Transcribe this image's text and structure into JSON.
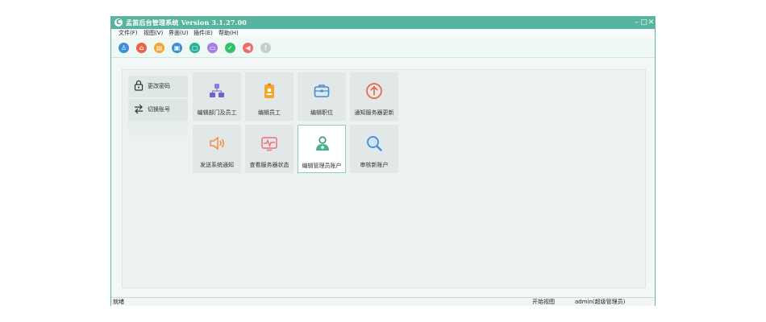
{
  "window": {
    "app_icon": "C",
    "title": "孟笛后台管理系统 Version 3.1.27.00",
    "controls": {
      "minimize": "–",
      "maximize": "□",
      "close": "✕"
    }
  },
  "menu": [
    {
      "label": "文件(F)"
    },
    {
      "label": "视图(V)"
    },
    {
      "label": "界面(U)"
    },
    {
      "label": "插件(E)"
    },
    {
      "label": "帮助(H)"
    }
  ],
  "toolbar": {
    "buttons": [
      {
        "icon": "user-icon",
        "glyph": "♙",
        "color": "#3f8fd8"
      },
      {
        "icon": "home-icon",
        "glyph": "⌂",
        "color": "#f0604a"
      },
      {
        "icon": "document-icon",
        "glyph": "▤",
        "color": "#f2a62c"
      },
      {
        "icon": "id-card-icon",
        "glyph": "▣",
        "color": "#3f8fd8"
      },
      {
        "icon": "contact-icon",
        "glyph": "▢",
        "color": "#28b09a"
      },
      {
        "icon": "keyboard-icon",
        "glyph": "▭",
        "color": "#a67ee6"
      },
      {
        "icon": "check-icon",
        "glyph": "✓",
        "color": "#35c06a"
      },
      {
        "icon": "speaker-icon",
        "glyph": "◀",
        "color": "#f06a6a"
      },
      {
        "icon": "info-icon",
        "glyph": "!",
        "color": "#c9cccc"
      }
    ]
  },
  "sidebar": {
    "change_password": {
      "label": "更改密码",
      "icon": "lock-icon"
    },
    "switch_account": {
      "label": "切换账号",
      "icon": "switch-arrows-icon"
    }
  },
  "tiles": [
    {
      "label": "编辑部门及员工",
      "icon": "org-chart-icon",
      "color": "#8a7fe0"
    },
    {
      "label": "编辑员工",
      "icon": "badge-icon",
      "color": "#f2a62c"
    },
    {
      "label": "编辑职位",
      "icon": "briefcase-icon",
      "color": "#3f8fd8"
    },
    {
      "label": "通知服务器更新",
      "icon": "upload-icon",
      "color": "#f0604a"
    },
    {
      "label": "发送系统通知",
      "icon": "speaker-icon",
      "color": "#f28b3c"
    },
    {
      "label": "查看服务器状态",
      "icon": "monitor-pulse-icon",
      "color": "#f0707a"
    },
    {
      "label": "编辑管理员账户",
      "icon": "admin-user-icon",
      "color": "#2f9a7a"
    },
    {
      "label": "审核新账户",
      "icon": "magnifier-icon",
      "color": "#3f8fd8"
    }
  ],
  "status": {
    "left": "就绪",
    "view": "开始视图",
    "user": "admin(超级管理员)"
  }
}
